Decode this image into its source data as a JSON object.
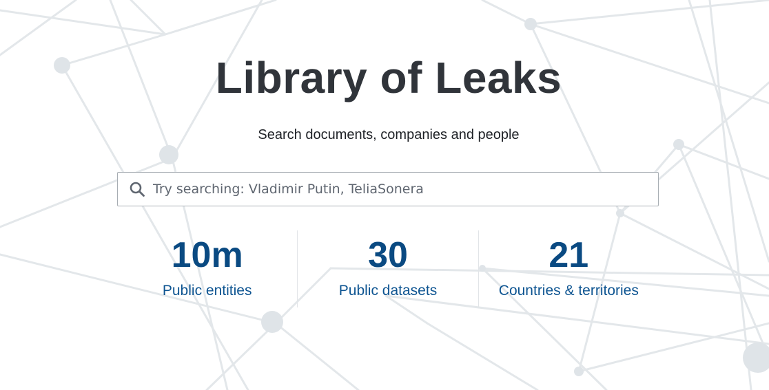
{
  "hero": {
    "title": "Library of Leaks",
    "subtitle": "Search documents, companies and people"
  },
  "search": {
    "placeholder": "Try searching: Vladimir Putin, TeliaSonera",
    "icon": "search-icon"
  },
  "stats": [
    {
      "value": "10m",
      "label": "Public entities"
    },
    {
      "value": "30",
      "label": "Public datasets"
    },
    {
      "value": "21",
      "label": "Countries & territories"
    }
  ],
  "colors": {
    "title": "#30343a",
    "accent": "#0a4a82",
    "background_network": "#dfe4e8"
  }
}
